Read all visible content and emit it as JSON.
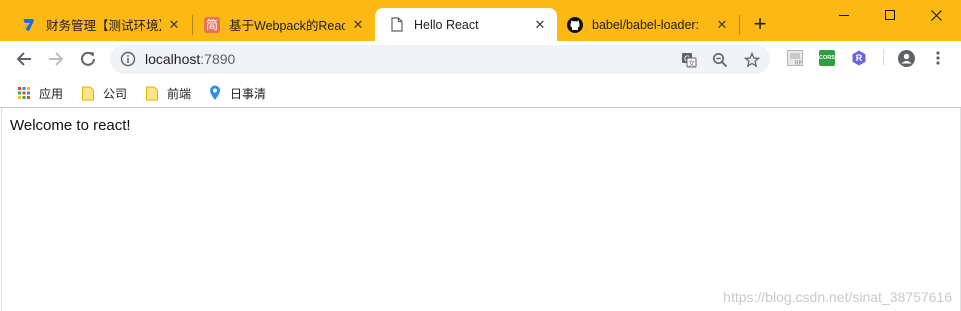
{
  "window": {
    "accent": "#FDB913",
    "controls": [
      "minimize-icon",
      "maximize-icon",
      "close-icon"
    ]
  },
  "tabs": [
    {
      "title": "财务管理【测试环境】",
      "favicon": "app-logo-icon",
      "active": false
    },
    {
      "title": "基于Webpack的React",
      "favicon": "jianshu-icon",
      "favicon_text": "简",
      "active": false
    },
    {
      "title": "Hello React",
      "favicon": "page-icon",
      "active": true
    },
    {
      "title": "babel/babel-loader:",
      "favicon": "github-icon",
      "active": false
    }
  ],
  "new_tab_label": "+",
  "toolbar": {
    "url_host": "localhost",
    "url_port": ":7890",
    "omnibox_icons": [
      "translate-icon",
      "zoom-icon",
      "star-icon"
    ],
    "extensions": [
      "rp-extension-icon",
      "cors-extension-icon",
      "r-extension-icon"
    ],
    "cors_label": "CORS",
    "r_label": "R"
  },
  "bookmarks": [
    {
      "label": "应用",
      "icon": "apps-grid-icon"
    },
    {
      "label": "公司",
      "icon": "folder-icon"
    },
    {
      "label": "前端",
      "icon": "folder-icon"
    },
    {
      "label": "日事清",
      "icon": "location-pin-icon"
    }
  ],
  "page": {
    "text": "Welcome to react!",
    "watermark": "https://blog.csdn.net/sinat_38757616"
  }
}
